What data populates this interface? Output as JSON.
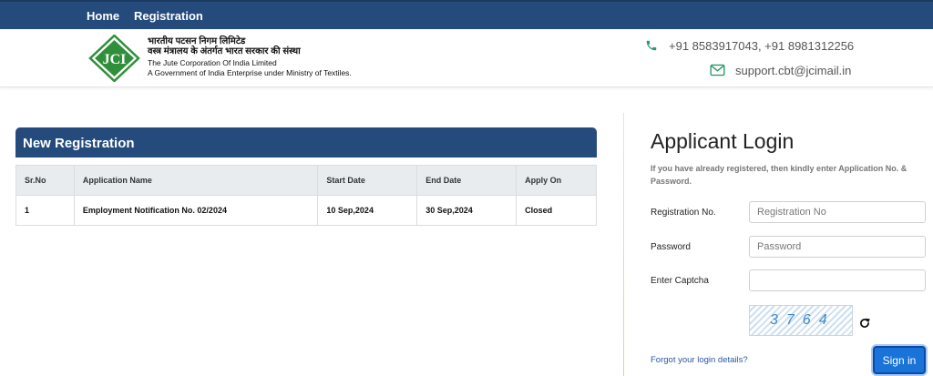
{
  "nav": {
    "home": "Home",
    "registration": "Registration"
  },
  "header": {
    "logo_text": "JCI",
    "org_hindi_1": "भारतीय पटसन निगम लिमिटेड",
    "org_hindi_2": "वस्त्र मंत्रालय के अंतर्गत भारत सरकार की संस्था",
    "org_english_1": "The Jute Corporation Of India Limited",
    "org_english_2": "A Government of India Enterprise under Ministry of Textiles.",
    "phone": "+91 8583917043, +91 8981312256",
    "email": "support.cbt@jcimail.in",
    "icons": {
      "phone": "phone-icon",
      "email": "email-icon"
    },
    "brand_color": "#244b7b",
    "logo_color": "#2f8f3a"
  },
  "registration": {
    "title": "New Registration",
    "columns": [
      "Sr.No",
      "Application Name",
      "Start Date",
      "End Date",
      "Apply On"
    ],
    "rows": [
      {
        "sr": "1",
        "name": "Employment Notification No. 02/2024",
        "start": "10 Sep,2024",
        "end": "30 Sep,2024",
        "apply": "Closed"
      }
    ]
  },
  "login": {
    "title": "Applicant Login",
    "subtitle": "If you have already registered, then kindly enter Application No. & Password.",
    "reg_label": "Registration No.",
    "reg_placeholder": "Registration No",
    "pw_label": "Password",
    "pw_placeholder": "Password",
    "captcha_label": "Enter Captcha",
    "captcha_value": "3764",
    "forgot": "Forgot your login details?",
    "signin": "Sign in",
    "button_color": "#1a73d9"
  }
}
